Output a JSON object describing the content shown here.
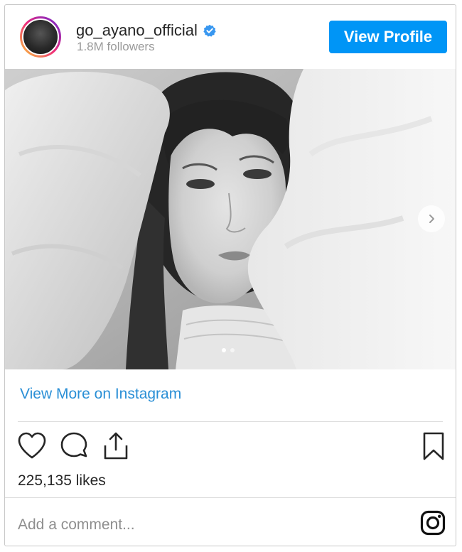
{
  "header": {
    "username": "go_ayano_official",
    "followers": "1.8M followers",
    "view_profile": "View Profile"
  },
  "post": {
    "carousel_count": 2,
    "carousel_active": 1,
    "view_more": "View More on Instagram",
    "likes": "225,135 likes",
    "comment_placeholder": "Add a comment..."
  },
  "colors": {
    "accent": "#0095f6",
    "link": "#2a8fd6",
    "verified": "#3897f0"
  },
  "icons": [
    "heart-icon",
    "comment-icon",
    "share-icon",
    "bookmark-icon",
    "instagram-logo-icon",
    "verified-icon",
    "chevron-right-icon"
  ]
}
